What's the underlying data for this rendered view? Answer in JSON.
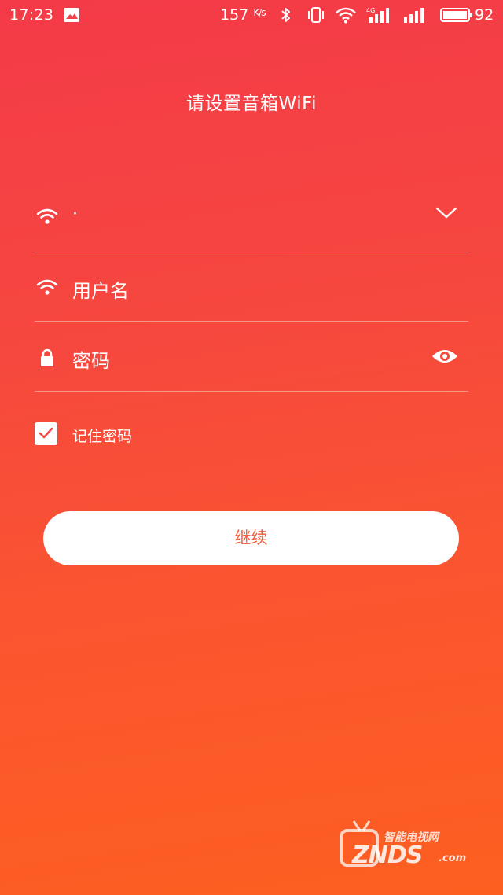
{
  "status_bar": {
    "time": "17:23",
    "speed": "157",
    "speed_unit": "K/s",
    "network": "4G",
    "battery": "92"
  },
  "page": {
    "title": "请设置音箱WiFi"
  },
  "form": {
    "ssid_value": "·",
    "username_placeholder": "用户名",
    "password_placeholder": "密码",
    "remember_label": "记住密码",
    "remember_checked": true,
    "continue_label": "继续"
  },
  "watermark": {
    "top_text": "智能电视网",
    "main_text": "ZNDS",
    "suffix": ".com"
  },
  "colors": {
    "gradient_top": "#f43a48",
    "gradient_bottom": "#fd5f20",
    "button_text": "#f25a3a",
    "check": "#f24a44"
  },
  "icons": [
    "image-notification-icon",
    "bluetooth-icon",
    "vibrate-icon",
    "wifi-signal-icon",
    "cellular-signal-icon",
    "battery-icon",
    "wifi-icon",
    "chevron-down-icon",
    "lock-icon",
    "eye-icon",
    "checkmark-icon"
  ]
}
